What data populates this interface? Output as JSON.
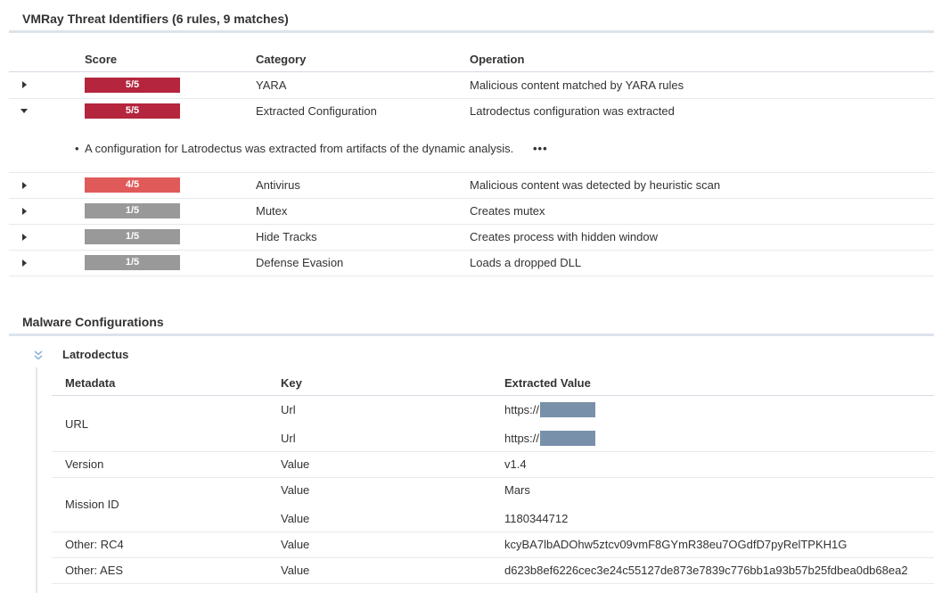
{
  "threat": {
    "title": "VMRay Threat Identifiers (6 rules, 9 matches)",
    "headers": {
      "score": "Score",
      "category": "Category",
      "operation": "Operation"
    },
    "rows": [
      {
        "score": "5/5",
        "color": "#b5253d",
        "category": "YARA",
        "operation": "Malicious content matched by YARA rules",
        "expanded": false
      },
      {
        "score": "5/5",
        "color": "#b5253d",
        "category": "Extracted Configuration",
        "operation": "Latrodectus configuration was extracted",
        "expanded": true
      },
      {
        "score": "4/5",
        "color": "#e05a5a",
        "category": "Antivirus",
        "operation": "Malicious content was detected by heuristic scan",
        "expanded": false
      },
      {
        "score": "1/5",
        "color": "#999999",
        "category": "Mutex",
        "operation": "Creates mutex",
        "expanded": false
      },
      {
        "score": "1/5",
        "color": "#999999",
        "category": "Hide Tracks",
        "operation": "Creates process with hidden window",
        "expanded": false
      },
      {
        "score": "1/5",
        "color": "#999999",
        "category": "Defense Evasion",
        "operation": "Loads a dropped DLL",
        "expanded": false
      }
    ],
    "detail": {
      "text": "A configuration for Latrodectus was extracted from artifacts of the dynamic analysis.",
      "more": "•••"
    }
  },
  "malware": {
    "title": "Malware Configurations",
    "family": "Latrodectus",
    "headers": {
      "metadata": "Metadata",
      "key": "Key",
      "value": "Extracted Value"
    },
    "rows": [
      {
        "metadata": "URL",
        "key": "Url",
        "value": "https://",
        "redacted": true
      },
      {
        "metadata": "",
        "key": "Url",
        "value": "https://",
        "redacted": true
      },
      {
        "metadata": "Version",
        "key": "Value",
        "value": "v1.4"
      },
      {
        "metadata": "Mission ID",
        "key": "Value",
        "value": "Mars"
      },
      {
        "metadata": "",
        "key": "Value",
        "value": "1180344712"
      },
      {
        "metadata": "Other: RC4",
        "key": "Value",
        "value": "kcyBA7lbADOhw5ztcv09vmF8GYmR38eu7OGdfD7pyRelTPKH1G"
      },
      {
        "metadata": "Other: AES",
        "key": "Value",
        "value": "d623b8ef6226cec3e24c55127de873e7839c776bb1a93b57b25fdbea0db68ea2"
      }
    ]
  }
}
